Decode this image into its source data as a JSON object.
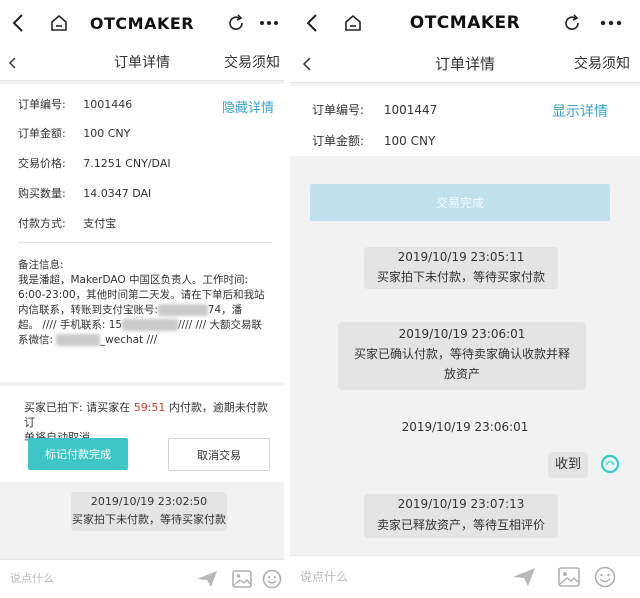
{
  "app_title": "OTCMAKER",
  "page_title": "订单详情",
  "nav_right": "交易须知",
  "left": {
    "order_no_label": "订单编号:",
    "order_no": "1001446",
    "toggle_label": "隐藏详情",
    "amount_label": "订单金额:",
    "amount": "100 CNY",
    "price_label": "交易价格:",
    "price": "7.1251 CNY/DAI",
    "qty_label": "购买数量:",
    "qty": "14.0347 DAI",
    "pay_label": "付款方式:",
    "pay": "支付宝",
    "note_title": "备注信息:",
    "note_line1": "我是潘超，MakerDAO 中国区负责人。工作时间:",
    "note_line2": "6:00-23:00，其他时间第二天发。请在下单后和我站",
    "note_line3a": "内信联系，转账到支付宝账号:",
    "note_line3b": "74，潘",
    "note_line4a": "超。 //// 手机联系: 15",
    "note_line4b": "//// /// 大额交易联",
    "note_line5a": "系微信:",
    "note_line5b": "_wechat ///",
    "status_prefix": "买家已拍下: 请买家在",
    "status_timer": "59:51",
    "status_suffix": "内付款，逾期未付款订",
    "status_line2": "单将自动取消",
    "btn_paid": "标记付款完成",
    "btn_cancel": "取消交易",
    "msg_time": "2019/10/19 23:02:50",
    "msg_text": "买家拍下未付款，等待买家付款",
    "input_placeholder": "说点什么"
  },
  "right": {
    "order_no_label": "订单编号:",
    "order_no": "1001447",
    "toggle_label": "显示详情",
    "amount_label": "订单金额:",
    "amount": "100 CNY",
    "done_button": "交易完成",
    "msg1_time": "2019/10/19 23:05:11",
    "msg1_text": "买家拍下未付款，等待买家付款",
    "msg2_time": "2019/10/19 23:06:01",
    "msg2_line1": "买家已确认付款，等待卖家确认收款并释",
    "msg2_line2": "放资产",
    "msg3_time": "2019/10/19 23:06:01",
    "msg3_text": "收到",
    "msg4_time": "2019/10/19 23:07:13",
    "msg4_text": "卖家已释放资产，等待互相评价",
    "input_placeholder": "说点什么"
  },
  "colors": {
    "accent": "#3ec6c6",
    "link": "#3aa4c6",
    "timer": "#d23c2c"
  },
  "icons": [
    "back-icon",
    "home-icon",
    "refresh-icon",
    "more-icon",
    "send-icon",
    "image-icon",
    "emoji-icon",
    "avatar-icon"
  ]
}
